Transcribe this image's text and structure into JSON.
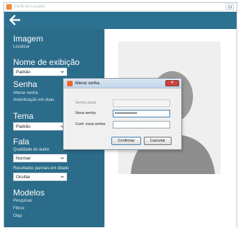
{
  "app": {
    "title": "Perfil do Usuário",
    "accent_color": "#2b6c8a",
    "header_color": "#2d7191"
  },
  "header": {
    "back_icon": "back-arrow-icon"
  },
  "sidebar": {
    "imagem": {
      "title": "Imagem",
      "link": "Localizar"
    },
    "nome_exibicao": {
      "title": "Nome de exibição",
      "selected": "Padrão"
    },
    "senha": {
      "title": "Senha",
      "links": [
        "Alterar senha",
        "Autenticação em duas"
      ]
    },
    "tema": {
      "title": "Tema",
      "selected": "Padrão"
    },
    "fala": {
      "title": "Fala",
      "audio_label": "Qualidade do áudio",
      "audio_selected": "Normal",
      "partial_label": "Resultados parciais em ditado",
      "partial_selected": "Ocultar"
    },
    "modelos": {
      "title": "Modelos",
      "links": [
        "Pesquisas",
        "Filtros",
        "Olap"
      ]
    }
  },
  "dialog": {
    "title": "Alterar senha",
    "fields": {
      "current": {
        "label": "Senha atual",
        "value": ""
      },
      "new": {
        "label": "Nova senha",
        "value": "••••••••••••••"
      },
      "confirm": {
        "label": "Conf. nova senha",
        "value": ""
      }
    },
    "buttons": {
      "confirm": "Confirmar",
      "cancel": "Cancelar"
    }
  }
}
